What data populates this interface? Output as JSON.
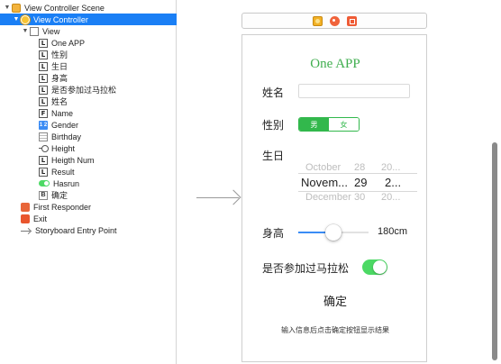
{
  "outline": {
    "items": [
      {
        "label": "View Controller Scene",
        "icon": "scene-icon",
        "glyph": "",
        "indent": 0,
        "expanded": true,
        "selected": false
      },
      {
        "label": "View Controller",
        "icon": "view-controller-icon",
        "glyph": "",
        "indent": 1,
        "expanded": true,
        "selected": true
      },
      {
        "label": "View",
        "icon": "view-icon",
        "glyph": "",
        "indent": 2,
        "expanded": true,
        "selected": false
      },
      {
        "label": "One APP",
        "icon": "label-icon",
        "glyph": "L",
        "indent": 3,
        "selected": false
      },
      {
        "label": "性别",
        "icon": "label-icon",
        "glyph": "L",
        "indent": 3,
        "selected": false
      },
      {
        "label": "生日",
        "icon": "label-icon",
        "glyph": "L",
        "indent": 3,
        "selected": false
      },
      {
        "label": "身高",
        "icon": "label-icon",
        "glyph": "L",
        "indent": 3,
        "selected": false
      },
      {
        "label": "是否参加过马拉松",
        "icon": "label-icon",
        "glyph": "L",
        "indent": 3,
        "selected": false
      },
      {
        "label": "姓名",
        "icon": "label-icon",
        "glyph": "L",
        "indent": 3,
        "selected": false
      },
      {
        "label": "Name",
        "icon": "textfield-icon",
        "glyph": "F",
        "indent": 3,
        "selected": false
      },
      {
        "label": "Gender",
        "icon": "segmented-control-icon",
        "glyph": "1 2",
        "indent": 3,
        "selected": false
      },
      {
        "label": "Birthday",
        "icon": "date-picker-icon",
        "glyph": "",
        "indent": 3,
        "selected": false
      },
      {
        "label": "Height",
        "icon": "slider-icon",
        "glyph": "",
        "indent": 3,
        "selected": false
      },
      {
        "label": "Heigth Num",
        "icon": "label-icon",
        "glyph": "L",
        "indent": 3,
        "selected": false
      },
      {
        "label": "Result",
        "icon": "label-icon",
        "glyph": "L",
        "indent": 3,
        "selected": false
      },
      {
        "label": "Hasrun",
        "icon": "switch-icon",
        "glyph": "",
        "indent": 3,
        "selected": false
      },
      {
        "label": "确定",
        "icon": "button-icon",
        "glyph": "B",
        "indent": 3,
        "selected": false
      },
      {
        "label": "First Responder",
        "icon": "first-responder-icon",
        "glyph": "",
        "indent": 1,
        "selected": false
      },
      {
        "label": "Exit",
        "icon": "exit-icon",
        "glyph": "",
        "indent": 1,
        "selected": false
      },
      {
        "label": "Storyboard Entry Point",
        "icon": "entry-point-icon",
        "glyph": "",
        "indent": 1,
        "selected": false
      }
    ]
  },
  "canvas": {
    "app_title": "One APP",
    "name_label": "姓名",
    "name_value": "",
    "gender_label": "性别",
    "gender_options": [
      "男",
      "女"
    ],
    "gender_selected_index": 0,
    "birthday_label": "生日",
    "picker": {
      "months": [
        "October",
        "Novem...",
        "December"
      ],
      "days": [
        "28",
        "29",
        "30"
      ],
      "years": [
        "20...",
        "2...",
        "20..."
      ]
    },
    "height_label": "身高",
    "height_value_text": "180cm",
    "height_slider_fraction": 0.5,
    "marathon_label": "是否参加过马拉松",
    "marathon_on": true,
    "confirm_label": "确定",
    "result_text": "输入信息后点击确定按钮显示结果"
  },
  "colors": {
    "selection": "#1a7ff5",
    "accent_green": "#32b84c",
    "switch_green": "#4cd964",
    "slider_blue": "#3a8cf5"
  }
}
